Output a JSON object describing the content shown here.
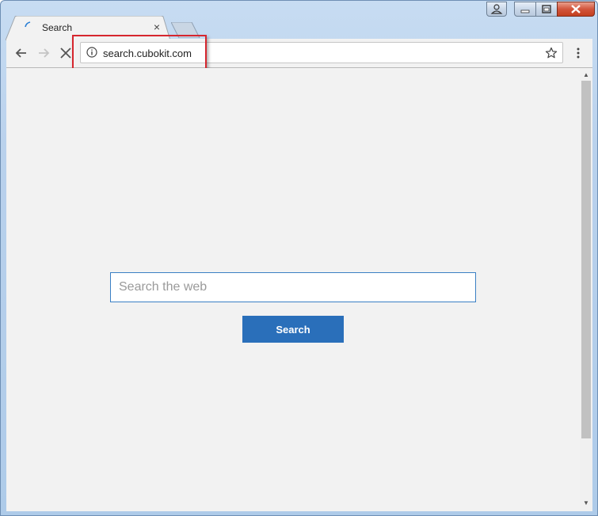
{
  "tab": {
    "title": "Search",
    "close_glyph": "×"
  },
  "window_controls": {
    "user": "user-icon",
    "minimize": "minimize-icon",
    "restore": "restore-icon",
    "close": "close-icon"
  },
  "toolbar": {
    "back": "back-arrow-icon",
    "forward": "forward-arrow-icon",
    "stop": "stop-icon",
    "info": "info-icon",
    "bookmark": "star-icon",
    "menu": "menu-dots-icon"
  },
  "address_bar": {
    "url": "search.cubokit.com"
  },
  "search": {
    "placeholder": "Search the web",
    "value": "",
    "button_label": "Search"
  },
  "colors": {
    "accent": "#2a6fba",
    "highlight": "#d6262e"
  }
}
